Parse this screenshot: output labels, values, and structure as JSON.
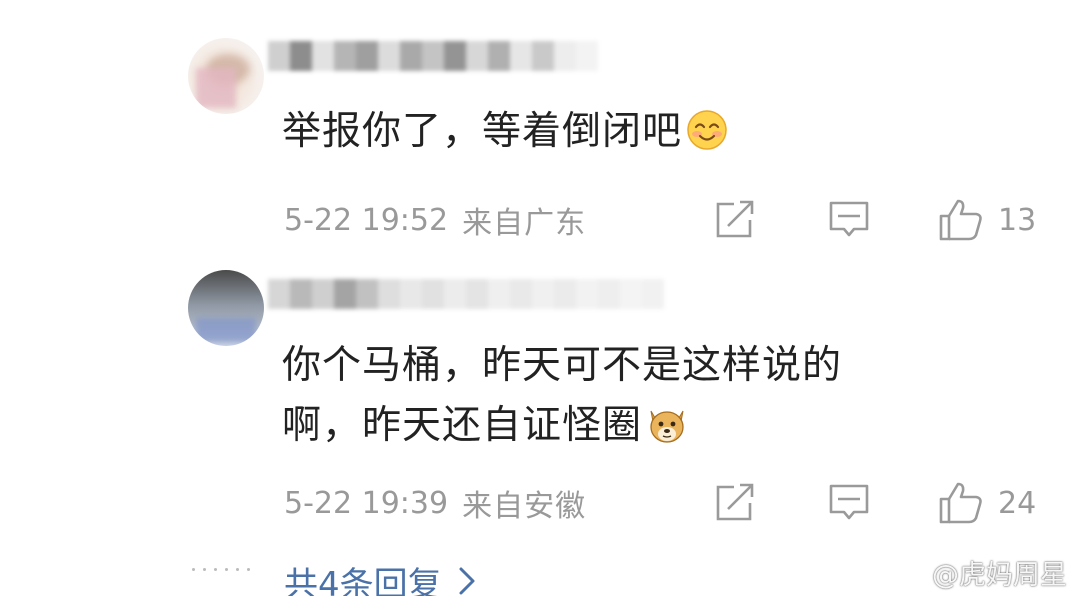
{
  "comments": [
    {
      "text": "举报你了，等着倒闭吧",
      "emoji": "smiling-face-emoji",
      "time": "5-22 19:52",
      "location": "来自广东",
      "likes": "13"
    },
    {
      "text_line1": "你个马桶，昨天可不是这样说的",
      "text_line2": "啊，昨天还自证怪圈",
      "emoji": "doge-emoji",
      "time": "5-22 19:39",
      "location": "来自安徽",
      "likes": "24"
    }
  ],
  "more_replies": {
    "label": "共4条回复",
    "chevron": "chevron-right-icon"
  },
  "watermark": {
    "logo": "weibo-logo",
    "text": "@虎妈周星"
  },
  "colors": {
    "text": "#222222",
    "meta": "#999999",
    "link": "#4a72a8",
    "icon": "#9a9a9a"
  }
}
